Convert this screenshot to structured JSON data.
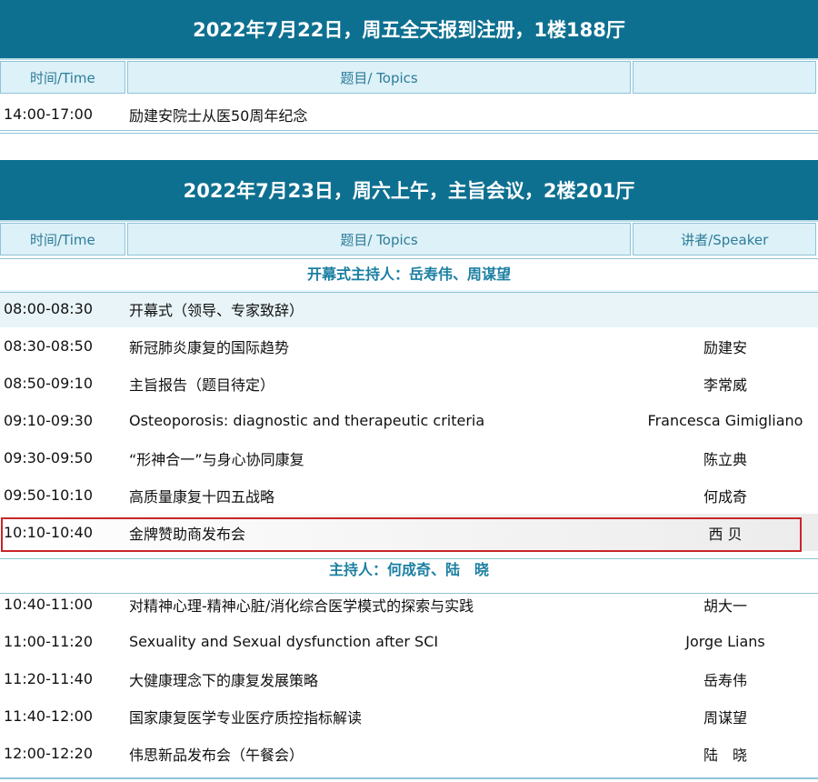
{
  "day1": {
    "header": "2022年7月22日，周五全天报到注册，1楼188厅",
    "columns": {
      "time": "时间/Time",
      "topic": "题目/ Topics",
      "speaker": ""
    },
    "rows": [
      {
        "time": "14:00-17:00",
        "topic": "励建安院士从医50周年纪念",
        "speaker": ""
      }
    ]
  },
  "day2": {
    "header": "2022年7月23日，周六上午，主旨会议，2楼201厅",
    "columns": {
      "time": "时间/Time",
      "topic": "题目/ Topics",
      "speaker": "讲者/Speaker"
    },
    "session1": {
      "title": "开幕式主持人：岳寿伟、周谋望",
      "rows": [
        {
          "time": "08:00-08:30",
          "topic": "开幕式（领导、专家致辞）",
          "speaker": ""
        },
        {
          "time": "08:30-08:50",
          "topic": "新冠肺炎康复的国际趋势",
          "speaker": "励建安"
        },
        {
          "time": "08:50-09:10",
          "topic": "主旨报告（题目待定）",
          "speaker": "李常威"
        },
        {
          "time": "09:10-09:30",
          "topic": "Osteoporosis: diagnostic and therapeutic criteria",
          "speaker": "Francesca Gimigliano"
        },
        {
          "time": "09:30-09:50",
          "topic": "“形神合一”与身心协同康复",
          "speaker": "陈立典"
        },
        {
          "time": "09:50-10:10",
          "topic": "高质量康复十四五战略",
          "speaker": "何成奇"
        },
        {
          "time": "10:10-10:40",
          "topic": "金牌赞助商发布会",
          "speaker": "西 贝"
        }
      ]
    },
    "session2": {
      "title": "主持人：何成奇、陆　晓",
      "rows": [
        {
          "time": "10:40-11:00",
          "topic": "对精神心理-精神心脏/消化综合医学模式的探索与实践",
          "speaker": "胡大一"
        },
        {
          "time": "11:00-11:20",
          "topic": "Sexuality and Sexual dysfunction after SCI",
          "speaker": "Jorge Lians"
        },
        {
          "time": "11:20-11:40",
          "topic": "大健康理念下的康复发展策略",
          "speaker": "岳寿伟"
        },
        {
          "time": "11:40-12:00",
          "topic": "国家康复医学专业医疗质控指标解读",
          "speaker": "周谋望"
        },
        {
          "time": "12:00-12:20",
          "topic": "伟思新品发布会（午餐会）",
          "speaker": "陆　晓"
        }
      ]
    }
  },
  "colors": {
    "header_bg": "#0e7090",
    "column_bg": "#ddf1f8",
    "accent_text": "#1b7fa2",
    "highlight_border": "#c8262a"
  }
}
